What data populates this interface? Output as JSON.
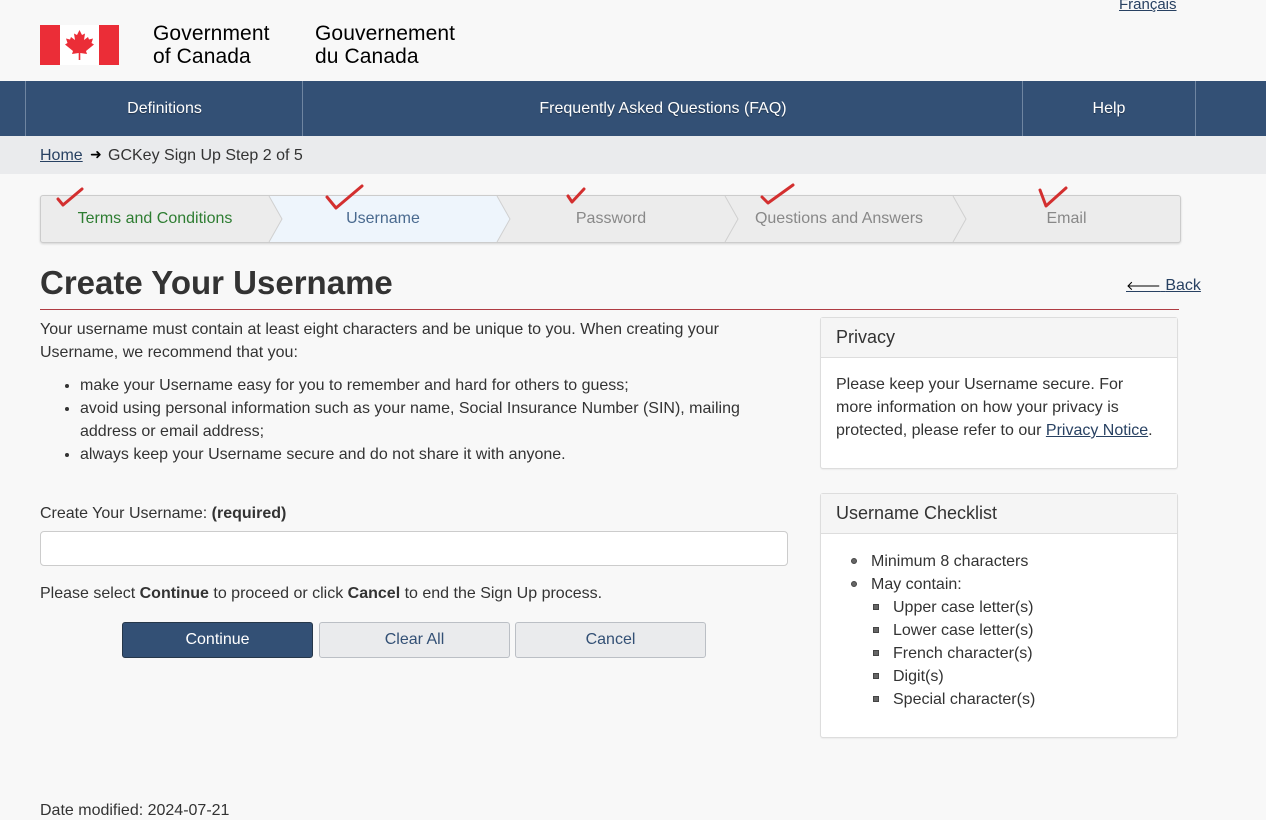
{
  "language_link": "Français",
  "signature": {
    "en_line1": "Government",
    "en_line2": "of Canada",
    "fr_line1": "Gouvernement",
    "fr_line2": "du Canada"
  },
  "nav": {
    "definitions": "Definitions",
    "faq": "Frequently Asked Questions (FAQ)",
    "help": "Help"
  },
  "breadcrumb": {
    "home": "Home",
    "current": "GCKey Sign Up Step 2 of 5"
  },
  "steps": [
    {
      "label": "Terms and Conditions",
      "state": "completed"
    },
    {
      "label": "Username",
      "state": "current"
    },
    {
      "label": "Password",
      "state": "pending"
    },
    {
      "label": "Questions and Answers",
      "state": "pending"
    },
    {
      "label": "Email",
      "state": "pending"
    }
  ],
  "page": {
    "title": "Create Your Username",
    "back_label": "Back",
    "intro": "Your username must contain at least eight characters and be unique to you. When creating your Username, we recommend that you:",
    "recommendations": [
      "make your Username easy for you to remember and hard for others to guess;",
      "avoid using personal information such as your name, Social Insurance Number (SIN), mailing address or email address;",
      "always keep your Username secure and do not share it with anyone."
    ],
    "field_label": "Create Your Username:",
    "required_label": "(required)",
    "username_value": "",
    "proceed_prefix": "Please select ",
    "proceed_continue": "Continue",
    "proceed_middle": " to proceed or click ",
    "proceed_cancel": "Cancel",
    "proceed_suffix": " to end the Sign Up process."
  },
  "buttons": {
    "continue": "Continue",
    "clear_all": "Clear All",
    "cancel": "Cancel"
  },
  "privacy_panel": {
    "title": "Privacy",
    "text": "Please keep your Username secure. For more information on how your privacy is protected, please refer to our ",
    "link": "Privacy Notice",
    "end": "."
  },
  "checklist_panel": {
    "title": "Username Checklist",
    "min": "Minimum 8 characters",
    "may_contain": "May contain:",
    "items": [
      "Upper case letter(s)",
      "Lower case letter(s)",
      "French character(s)",
      "Digit(s)",
      "Special character(s)"
    ]
  },
  "footer": {
    "date_modified": "Date modified: 2024-07-21"
  },
  "colors": {
    "nav_bg": "#335075",
    "rule": "#af3c43",
    "completed_step": "#2e7d32",
    "current_step_bg": "#eef5fc",
    "checkmark": "#d32f2f",
    "flag_red": "#eb2d37"
  }
}
